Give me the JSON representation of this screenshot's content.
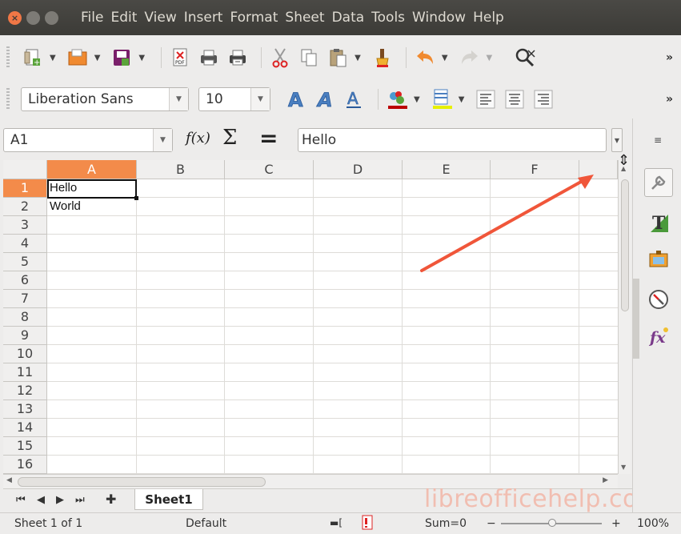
{
  "menubar": {
    "items": [
      "File",
      "Edit",
      "View",
      "Insert",
      "Format",
      "Sheet",
      "Data",
      "Tools",
      "Window",
      "Help"
    ]
  },
  "font_toolbar": {
    "font_name": "Liberation Sans",
    "font_size": "10"
  },
  "formula_bar": {
    "name_box": "A1",
    "fx_label": "f(x)",
    "sigma_label": "Σ",
    "equals_label": "=",
    "input_value": "Hello"
  },
  "grid": {
    "columns": [
      "A",
      "B",
      "C",
      "D",
      "E",
      "F"
    ],
    "rows": [
      "1",
      "2",
      "3",
      "4",
      "5",
      "6",
      "7",
      "8",
      "9",
      "10",
      "11",
      "12",
      "13",
      "14",
      "15",
      "16"
    ],
    "active_cell": "A1",
    "cells": {
      "A1": "Hello",
      "A2": "World"
    }
  },
  "sheet_tabs": {
    "tabs": [
      "Sheet1"
    ]
  },
  "watermark": "libreofficehelp.com",
  "statusbar": {
    "sheet_info": "Sheet 1 of 1",
    "page_style": "Default",
    "sum": "Sum=0",
    "zoom_minus": "−",
    "zoom_plus": "+",
    "zoom": "100%"
  },
  "colors": {
    "accent": "#f38b4a",
    "annotation_arrow": "#f0563a"
  }
}
